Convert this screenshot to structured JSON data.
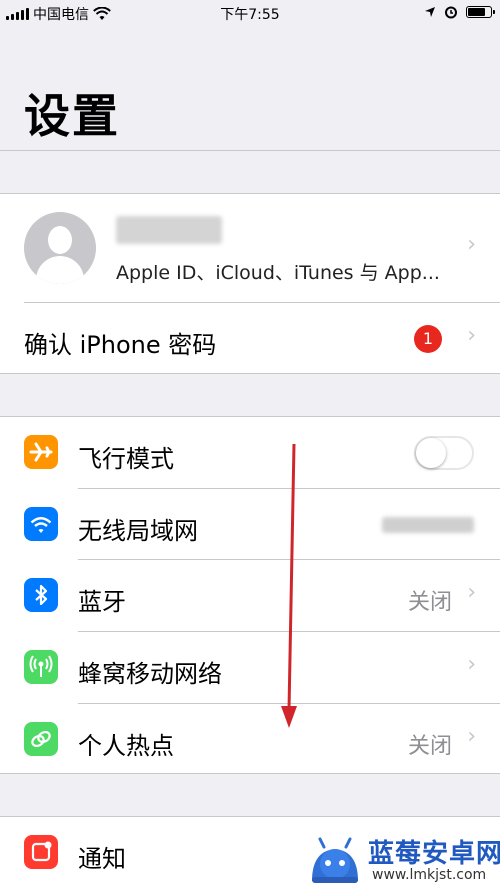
{
  "status_bar": {
    "carrier": "中国电信",
    "time": "下午7:55"
  },
  "header": {
    "title": "设置"
  },
  "profile": {
    "subtitle": "Apple ID、iCloud、iTunes 与 App..."
  },
  "confirm_password": {
    "label": "确认 iPhone 密码",
    "badge": "1"
  },
  "network_items": [
    {
      "label": "飞行模式",
      "icon": "airplane-icon",
      "color": "#ff9500",
      "toggle_on": false
    },
    {
      "label": "无线局域网",
      "icon": "wifi-icon",
      "color": "#007aff",
      "value": ""
    },
    {
      "label": "蓝牙",
      "icon": "bluetooth-icon",
      "color": "#007aff",
      "value": "关闭"
    },
    {
      "label": "蜂窝移动网络",
      "icon": "cellular-icon",
      "color": "#4cd964",
      "value": ""
    },
    {
      "label": "个人热点",
      "icon": "hotspot-icon",
      "color": "#4cd964",
      "value": "关闭"
    }
  ],
  "notifications": {
    "label": "通知",
    "icon": "notifications-icon",
    "color": "#ff3b30"
  },
  "watermark": {
    "name": "蓝莓安卓网",
    "url": "www.lmkjst.com"
  },
  "colors": {
    "arrow": "#d0262b",
    "badge": "#e8281f"
  }
}
